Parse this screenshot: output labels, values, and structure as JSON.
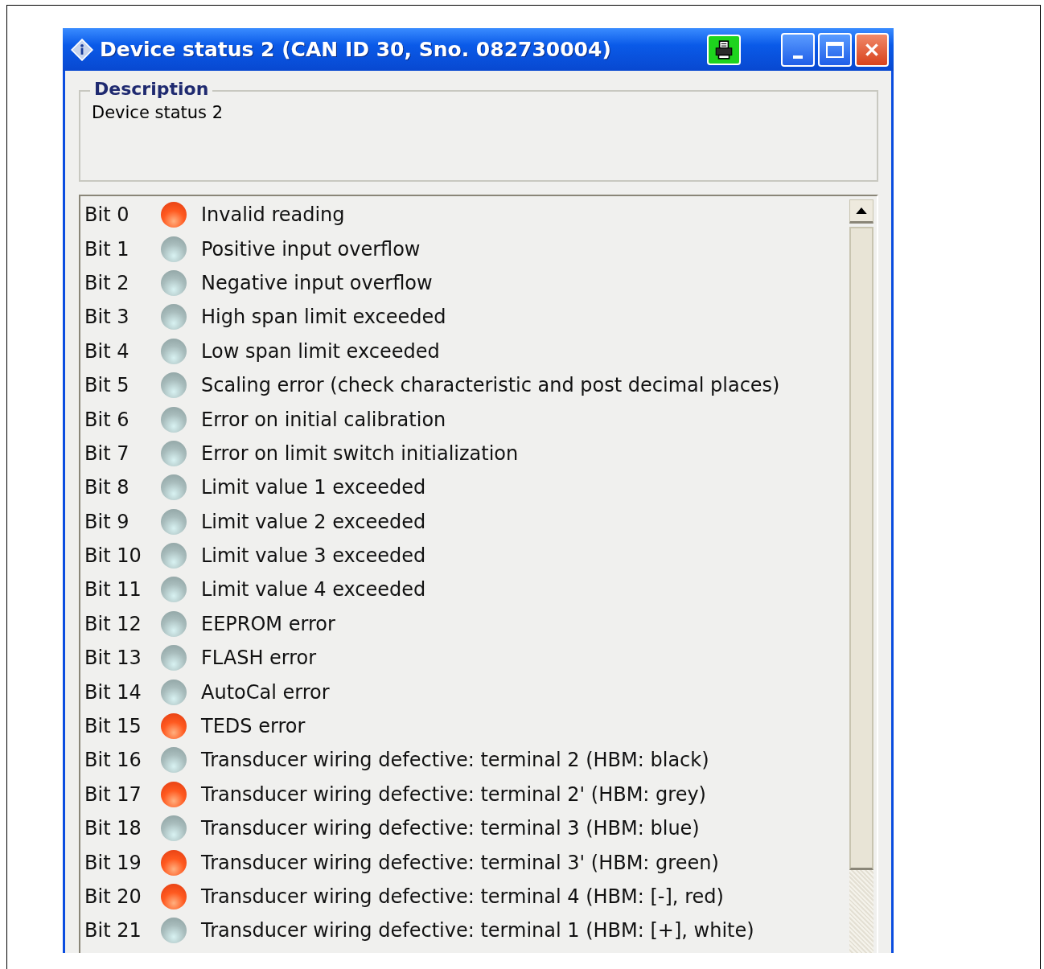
{
  "window": {
    "title": "Device status 2 (CAN ID 30, Sno. 082730004)"
  },
  "description": {
    "legend": "Description",
    "text": "Device status 2"
  },
  "bits": [
    {
      "label": "Bit 0",
      "text": "Invalid reading",
      "active": true
    },
    {
      "label": "Bit 1",
      "text": "Positive input overflow",
      "active": false
    },
    {
      "label": "Bit 2",
      "text": "Negative input overflow",
      "active": false
    },
    {
      "label": "Bit 3",
      "text": "High span limit exceeded",
      "active": false
    },
    {
      "label": "Bit 4",
      "text": "Low span limit exceeded",
      "active": false
    },
    {
      "label": "Bit 5",
      "text": "Scaling error (check characteristic and post decimal places)",
      "active": false
    },
    {
      "label": "Bit 6",
      "text": "Error on initial calibration",
      "active": false
    },
    {
      "label": "Bit 7",
      "text": "Error on limit switch initialization",
      "active": false
    },
    {
      "label": "Bit 8",
      "text": "Limit value 1 exceeded",
      "active": false
    },
    {
      "label": "Bit 9",
      "text": "Limit value 2 exceeded",
      "active": false
    },
    {
      "label": "Bit 10",
      "text": "Limit value 3 exceeded",
      "active": false
    },
    {
      "label": "Bit 11",
      "text": "Limit value 4 exceeded",
      "active": false
    },
    {
      "label": "Bit 12",
      "text": "EEPROM error",
      "active": false
    },
    {
      "label": "Bit 13",
      "text": "FLASH error",
      "active": false
    },
    {
      "label": "Bit 14",
      "text": "AutoCal error",
      "active": false
    },
    {
      "label": "Bit 15",
      "text": "TEDS error",
      "active": true
    },
    {
      "label": "Bit 16",
      "text": "Transducer wiring defective: terminal 2 (HBM: black)",
      "active": false
    },
    {
      "label": "Bit 17",
      "text": "Transducer wiring defective: terminal 2' (HBM: grey)",
      "active": true
    },
    {
      "label": "Bit 18",
      "text": "Transducer wiring defective: terminal 3 (HBM: blue)",
      "active": false
    },
    {
      "label": "Bit 19",
      "text": "Transducer wiring defective: terminal 3' (HBM: green)",
      "active": true
    },
    {
      "label": "Bit 20",
      "text": "Transducer wiring defective: terminal 4 (HBM: [-], red)",
      "active": true
    },
    {
      "label": "Bit 21",
      "text": "Transducer wiring defective: terminal 1 (HBM: [+], white)",
      "active": false
    }
  ]
}
